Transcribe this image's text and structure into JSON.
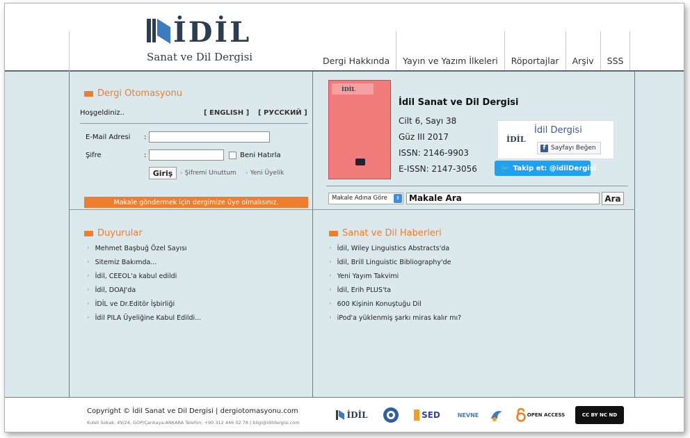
{
  "header": {
    "logo_word": "İDİL",
    "logo_subtitle": "Sanat ve Dil Dergisi",
    "nav": [
      "Dergi Hakkında",
      "Yayın ve Yazım İlkeleri",
      "Röportajlar",
      "Arşiv",
      "SSS"
    ]
  },
  "login": {
    "title": "Dergi Otomasyonu",
    "welcome": "Hoşgeldiniz..",
    "lang_en": "[ ENGLISH ]",
    "lang_ru": "[ РУССКИЙ ]",
    "email_label": "E-Mail Adresi",
    "password_label": "Şifre",
    "remember_label": "Beni Hatırla",
    "login_button": "Giriş",
    "forgot_link": "Şifremi Unuttum",
    "register_link": "Yeni Üyelik",
    "notice": "Makale göndermek için dergimize üye olmalısınız."
  },
  "journal": {
    "title": "İdil Sanat ve Dil Dergisi",
    "volume": "Cilt 6, Sayı 38",
    "season": "Güz III 2017",
    "issn": "ISSN: 2146-9903",
    "eissn": "E-ISSN: 2147-3056",
    "cover_logo": "İDİL"
  },
  "facebook": {
    "name": "İdil Dergisi",
    "logo": "İDİL",
    "like_label": "Sayfayı Beğen"
  },
  "twitter": {
    "label": "Takip et: @idilDergisi"
  },
  "search": {
    "select_value": "Makale Adına Göre",
    "input_value": "Makale Ara",
    "button": "Ara"
  },
  "announcements": {
    "title": "Duyurular",
    "items": [
      "Mehmet Başbuğ Özel Sayısı",
      "Sitemiz Bakımda...",
      "İdil, CEEOL'a kabul edildi",
      "İdil, DOAJ'da",
      "İDİL ve Dr.Editör İşbirliği",
      "İdil PILA Üyeliğine Kabul Edildi..."
    ]
  },
  "news": {
    "title": "Sanat ve Dil Haberleri",
    "items": [
      "İdil, Wiley Linguistics Abstracts'da",
      "İdil, Brill Linguistic Bibliography'de",
      "Yeni Yayım Takvimi",
      "İdil, Erih PLUS'ta",
      "600 Kişinin Konuştuğu Dil",
      "iPod'a yüklenmiş şarkı miras kalır mı?"
    ]
  },
  "footer": {
    "copyright": "Copyright © İdil Sanat ve Dil Dergisi | dergiotomasyonu.com",
    "address": "Kuleli Sokak, 49/24, GOP/Çankaya-ANKARA Telefon: +90 312 446 02 78 | bilgi@idildergisi.com",
    "partners": [
      "İDİL",
      "SED",
      "NEVNE",
      "OPEN ACCESS",
      "CC BY NC ND"
    ]
  },
  "colors": {
    "accent": "#ef7d2e",
    "background": "#dbe9ec",
    "twitter": "#1da1f2",
    "facebook": "#3b5998",
    "cover": "#f17b7b"
  }
}
